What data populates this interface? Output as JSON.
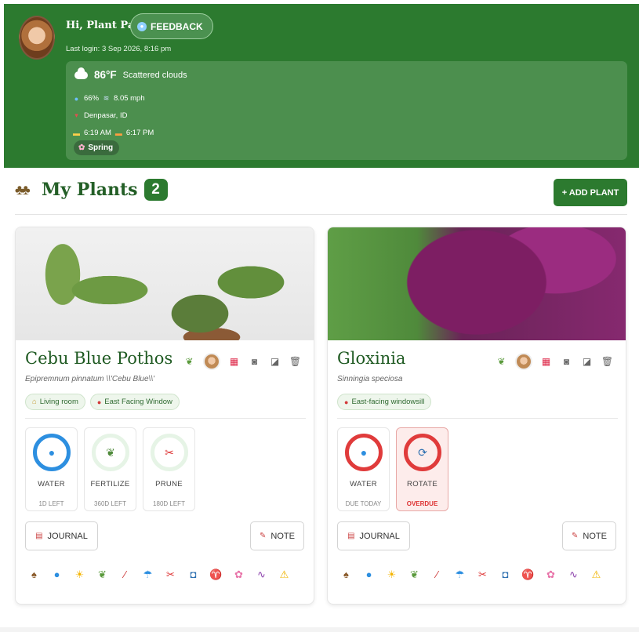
{
  "header": {
    "greeting": "Hi, Plant Parent",
    "feedback_label": "FEEDBACK",
    "last_login": "Last login: 3 Sep 2026, 8:16 pm",
    "weather": {
      "temperature": "86°F",
      "description": "Scattered clouds",
      "humidity": "66%",
      "wind": "8.05 mph",
      "location": "Denpasar, ID",
      "sunrise": "6:19 AM",
      "sunset": "6:17 PM",
      "season": "Spring"
    }
  },
  "plants_section": {
    "title": "My Plants",
    "count": "2",
    "add_label": "+ ADD PLANT"
  },
  "plants": [
    {
      "name": "Cebu Blue Pothos",
      "scientific": "Epipremnum pinnatum \\\\'Cebu Blue\\\\'",
      "tags": [
        "Living room",
        "East Facing Window"
      ],
      "tasks": [
        {
          "label": "WATER",
          "status": "1D LEFT"
        },
        {
          "label": "FERTILIZE",
          "status": "360D LEFT"
        },
        {
          "label": "PRUNE",
          "status": "180D LEFT"
        }
      ],
      "journal_label": "JOURNAL",
      "note_label": "NOTE"
    },
    {
      "name": "Gloxinia",
      "scientific": "Sinningia speciosa",
      "tags": [
        "East-facing windowsill"
      ],
      "tasks": [
        {
          "label": "WATER",
          "status": "DUE TODAY"
        },
        {
          "label": "ROTATE",
          "status": "OVERDUE"
        }
      ],
      "journal_label": "JOURNAL",
      "note_label": "NOTE"
    }
  ],
  "colors": {
    "header_green": "#2c7a2f",
    "water_blue": "#2d8fe0",
    "overdue_red": "#e03b3b"
  }
}
